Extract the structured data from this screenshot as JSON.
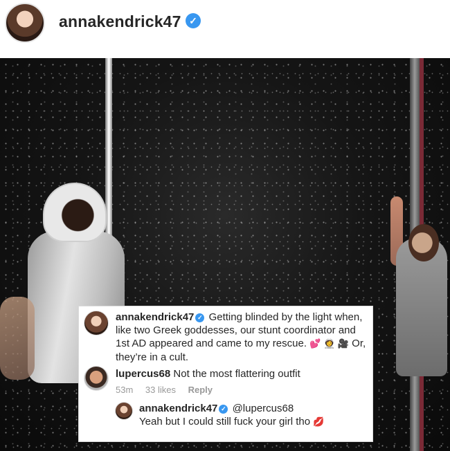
{
  "header": {
    "username": "annakendrick47",
    "verified_icon": "verified-badge-icon",
    "verified_glyph": "✓"
  },
  "comments": [
    {
      "username": "annakendrick47",
      "verified_glyph": "✓",
      "text": "Getting blinded by the light when, like two Greek goddesses, our stunt coordinator and 1st AD appeared and came to my rescue.",
      "emojis": "💕 👩‍🚀 🎥",
      "text2": "Or, they’re in a cult."
    },
    {
      "username": "lupercus68",
      "text": "Not the most flattering outfit",
      "time": "53m",
      "likes": "33 likes",
      "reply_label": "Reply"
    },
    {
      "username": "annakendrick47",
      "verified_glyph": "✓",
      "mention": "@lupercus68",
      "text": "Yeah but I could still fuck your girl tho",
      "emoji": "💋"
    }
  ],
  "colors": {
    "verified_blue": "#3897f0",
    "meta_gray": "#999999",
    "text": "#262626"
  }
}
